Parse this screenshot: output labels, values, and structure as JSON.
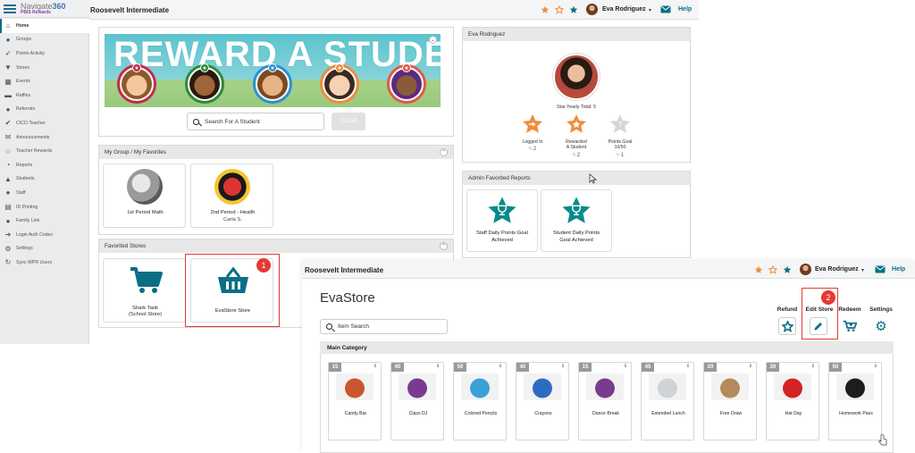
{
  "app": {
    "brand": "Navigate360",
    "brand_prefix": "Navigate",
    "brand_number": "360",
    "product": "PBIS Rewards"
  },
  "header": {
    "school": "Roosevelt Intermediate",
    "user": "Eva Rodriguez",
    "help": "Help"
  },
  "sidebar": {
    "items": [
      {
        "label": "Home",
        "icon": "home-icon"
      },
      {
        "label": "Groups",
        "icon": "groups-icon"
      },
      {
        "label": "Points Activity",
        "icon": "rocket-icon"
      },
      {
        "label": "Stores",
        "icon": "cart-icon"
      },
      {
        "label": "Events",
        "icon": "calendar-icon"
      },
      {
        "label": "Raffles",
        "icon": "ticket-icon"
      },
      {
        "label": "Referrals",
        "icon": "alert-icon"
      },
      {
        "label": "CICO Teacher",
        "icon": "check-circle-icon"
      },
      {
        "label": "Announcements",
        "icon": "envelope-icon"
      },
      {
        "label": "Teacher Rewards",
        "icon": "star-outline-icon"
      },
      {
        "label": "Reports",
        "icon": "pie-chart-icon"
      },
      {
        "label": "Students",
        "icon": "graduation-cap-icon"
      },
      {
        "label": "Staff",
        "icon": "person-icon"
      },
      {
        "label": "ID Printing",
        "icon": "printer-icon"
      },
      {
        "label": "Family Link",
        "icon": "family-icon"
      },
      {
        "label": "Login Auth Codes",
        "icon": "login-icon"
      },
      {
        "label": "Settings",
        "icon": "gear-icon"
      },
      {
        "label": "Sync WPR Users",
        "icon": "sync-icon"
      }
    ]
  },
  "banner": {
    "title": "REWARD A STUDENT",
    "search_placeholder": "Search For A Student",
    "clear_label": "CLEAR"
  },
  "groups": {
    "title": "My Group / My Favorites",
    "cards": [
      {
        "name": "1st Period Math",
        "sub": ""
      },
      {
        "name": "2nd Period - Health",
        "sub": "Carla S."
      }
    ]
  },
  "stores": {
    "title": "Favorited Stores",
    "cards": [
      {
        "name_line1": "Shark Tank",
        "name_line2": "(School Store)"
      },
      {
        "name_line1": "EvaStore Store",
        "name_line2": ""
      }
    ]
  },
  "profile": {
    "title": "Eva Rodriguez",
    "star_total_label": "Star Yearly Total: 5",
    "stats": [
      {
        "line1": "Logged In",
        "line2": "",
        "line3": "",
        "count": "2"
      },
      {
        "line1": "Rewarded",
        "line2": "A Student",
        "line3": "",
        "count": "2"
      },
      {
        "line1": "Points Goal",
        "line2": "10/50",
        "line3": "",
        "count": "1"
      }
    ]
  },
  "reports": {
    "title": "Admin Favorited Reports",
    "cards": [
      {
        "line1": "Staff Daily Points Goal",
        "line2": "Achieved"
      },
      {
        "line1": "Student Daily Points",
        "line2": "Goal Achieved"
      }
    ]
  },
  "callouts": {
    "one": "1",
    "two": "2"
  },
  "store_page": {
    "school": "Roosevelt Intermediate",
    "user": "Eva Rodriguez",
    "help": "Help",
    "title": "EvaStore",
    "search_placeholder": "Item Search",
    "tools": [
      {
        "label": "Refund",
        "icon": "star-refund-icon"
      },
      {
        "label": "Edit Store",
        "icon": "pencil-icon"
      },
      {
        "label": "Redeem",
        "icon": "cart-plus-icon"
      },
      {
        "label": "Settings",
        "icon": "gear-icon"
      }
    ],
    "category": "Main Category",
    "items": [
      {
        "price": "15",
        "name": "Candy Bar",
        "color": "#c9562e"
      },
      {
        "price": "40",
        "name": "Class DJ",
        "color": "#7a3b8f"
      },
      {
        "price": "50",
        "name": "Colored Pencils",
        "color": "#3aa0d8"
      },
      {
        "price": "40",
        "name": "Crayons",
        "color": "#2d6bc2"
      },
      {
        "price": "15",
        "name": "Dance Break",
        "color": "#7a3b8f"
      },
      {
        "price": "45",
        "name": "Extended Lunch",
        "color": "#d0d3d6"
      },
      {
        "price": "20",
        "name": "Free Draw",
        "color": "#b58a5a"
      },
      {
        "price": "20",
        "name": "Hat Day",
        "color": "#d32323"
      },
      {
        "price": "50",
        "name": "Homework Pass",
        "color": "#1d1d1d"
      }
    ],
    "info_glyph": "i"
  },
  "colors": {
    "teal": "#0b6f85",
    "orange_star": "#f08c3a",
    "callout_red": "#e53935"
  }
}
